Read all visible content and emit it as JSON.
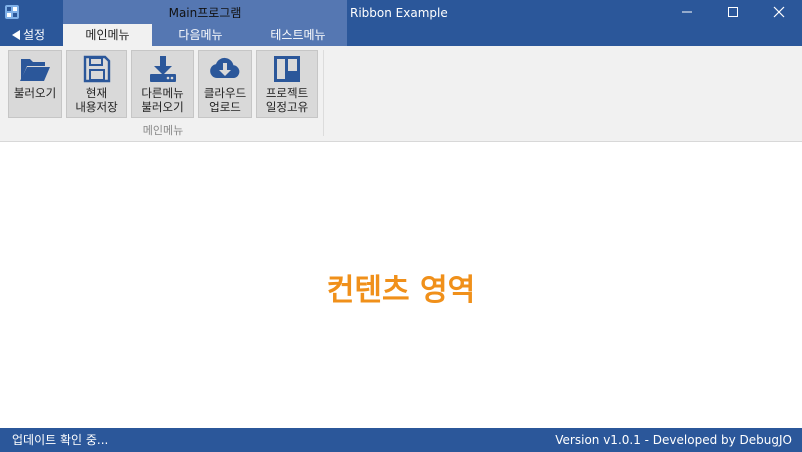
{
  "window": {
    "title": "Ribbon Example",
    "context_group_title": "Main프로그램"
  },
  "tabs": {
    "backstage_label": "설정",
    "items": [
      {
        "label": "메인메뉴",
        "active": true
      },
      {
        "label": "다음메뉴",
        "active": false
      },
      {
        "label": "테스트메뉴",
        "active": false
      }
    ]
  },
  "ribbon": {
    "group_label": "메인메뉴",
    "buttons": [
      {
        "label": "불러오기",
        "icon": "folder-open-icon"
      },
      {
        "label": "현재\n내용저장",
        "icon": "floppy-save-icon"
      },
      {
        "label": "다른메뉴\n불러오기",
        "icon": "download-icon"
      },
      {
        "label": "클라우드\n업로드",
        "icon": "cloud-download-icon"
      },
      {
        "label": "프로젝트\n일정고유",
        "icon": "board-columns-icon"
      }
    ]
  },
  "content": {
    "text": "컨텐츠 영역",
    "color": "#f0901a"
  },
  "status": {
    "left": "업데이트 확인 중...",
    "right": "Version v1.0.1 - Developed by DebugJO"
  },
  "colors": {
    "titlebar": "#2b579a",
    "context": "#5577b2",
    "icon_blue": "#2b579a"
  }
}
